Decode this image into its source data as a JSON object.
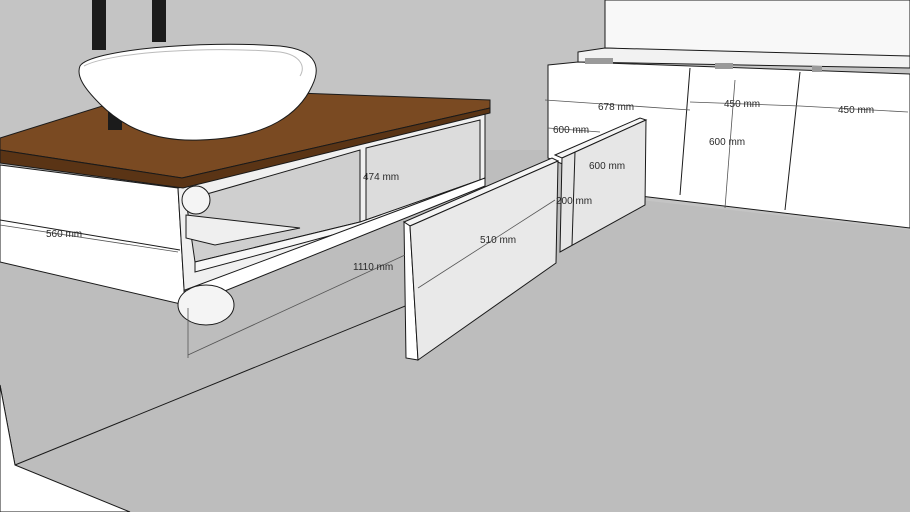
{
  "dimensions": {
    "vanity_depth": "560 mm",
    "vanity_length": "1110 mm",
    "shelf_width": "474 mm",
    "front_panel_length": "510 mm",
    "front_panel_height": "200 mm",
    "back_panel_length": "600 mm",
    "cabinet_width_1": "678 mm",
    "cabinet_width_2": "450 mm",
    "cabinet_width_3": "450 mm",
    "cabinet_depth": "600 mm",
    "cabinet_height": "600 mm"
  },
  "colors": {
    "background_wall": "#c4c4c4",
    "floor": "#bdbdbd",
    "countertop": "#7a4a22",
    "cabinet_white": "#ffffff",
    "panel_grey": "#e9e9e9"
  }
}
